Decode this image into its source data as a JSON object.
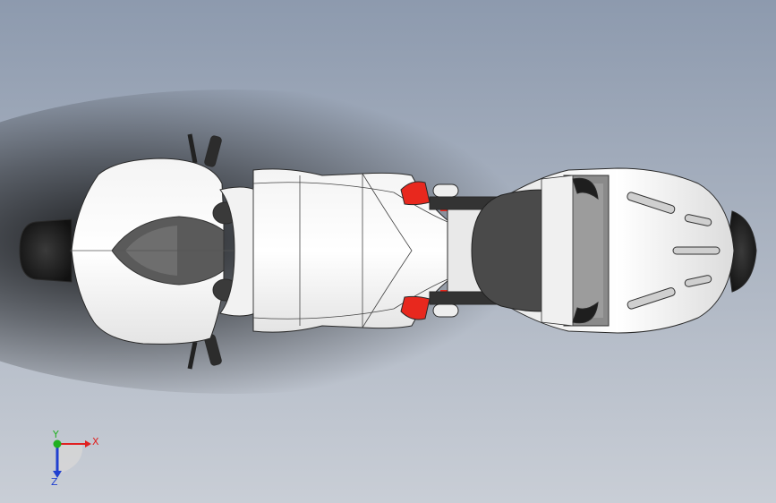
{
  "window": {
    "background_top": "#8d9aae",
    "background_mid": "#b7bfcc",
    "background_bottom": "#c9ced6"
  },
  "model": {
    "body_color": "#ffffff",
    "accent_color": "#e8281e",
    "dark_color": "#4a4a4a",
    "tire_color": "#1e1e1e",
    "edge_color": "#2a2a2a"
  },
  "triad": {
    "x_label": "X",
    "y_label": "Y",
    "z_label": "Z",
    "x_color": "#e02020",
    "y_color": "#20b020",
    "z_color": "#2040d0"
  }
}
